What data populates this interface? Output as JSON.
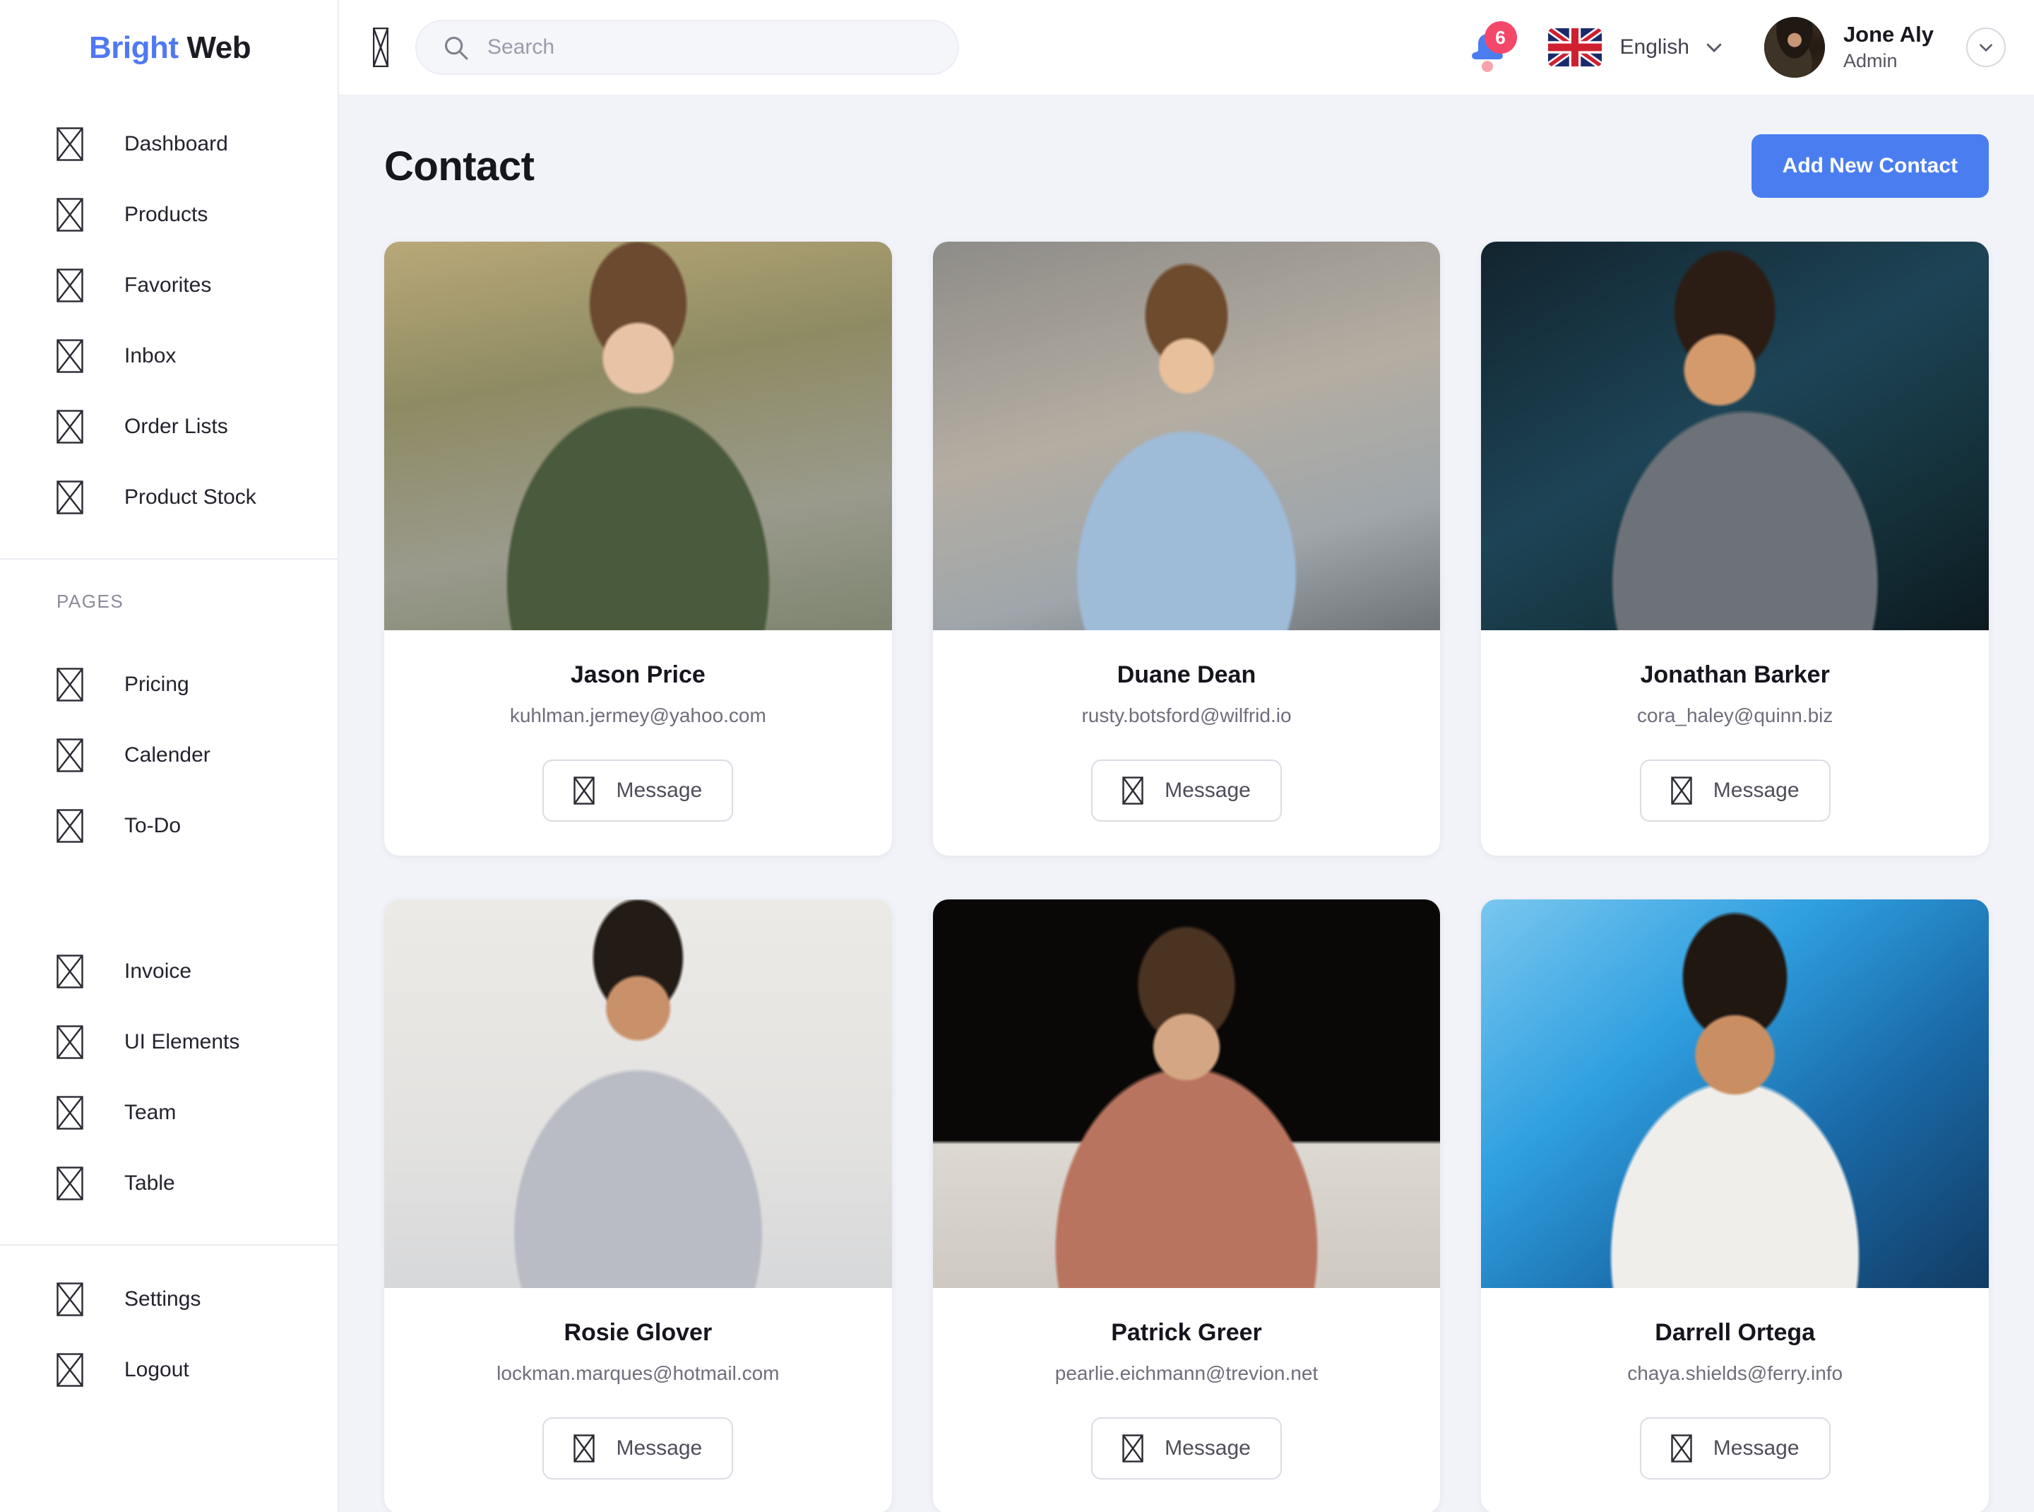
{
  "brand": {
    "first": "Bright",
    "second": "Web"
  },
  "sidebar": {
    "groups": [
      {
        "items": [
          {
            "label": "Dashboard",
            "icon": "broken-image-icon"
          },
          {
            "label": "Products",
            "icon": "broken-image-icon"
          },
          {
            "label": "Favorites",
            "icon": "broken-image-icon"
          },
          {
            "label": "Inbox",
            "icon": "broken-image-icon"
          },
          {
            "label": "Order Lists",
            "icon": "broken-image-icon"
          },
          {
            "label": "Product Stock",
            "icon": "broken-image-icon"
          }
        ]
      },
      {
        "section": "PAGES",
        "items": [
          {
            "label": "Pricing",
            "icon": "broken-image-icon"
          },
          {
            "label": "Calender",
            "icon": "broken-image-icon"
          },
          {
            "label": "To-Do",
            "icon": "broken-image-icon"
          }
        ]
      },
      {
        "items": [
          {
            "label": "Invoice",
            "icon": "broken-image-icon"
          },
          {
            "label": "UI Elements",
            "icon": "broken-image-icon"
          },
          {
            "label": "Team",
            "icon": "broken-image-icon"
          },
          {
            "label": "Table",
            "icon": "broken-image-icon"
          }
        ]
      },
      {
        "items": [
          {
            "label": "Settings",
            "icon": "broken-image-icon"
          },
          {
            "label": "Logout",
            "icon": "broken-image-icon"
          }
        ]
      }
    ]
  },
  "topbar": {
    "menu_icon": "broken-image-icon",
    "search": {
      "value": "",
      "placeholder": "Search",
      "icon": "search-icon"
    },
    "notifications": {
      "icon": "bell-icon",
      "count": "6",
      "badge_color": "#f4486b",
      "bell_color": "#4a7ef0"
    },
    "language": {
      "label": "English",
      "flag": "uk-flag-icon",
      "caret": "chevron-down-icon"
    },
    "user": {
      "name": "Jone Aly",
      "role": "Admin",
      "avatar": "avatar",
      "caret": "chevron-down-icon"
    }
  },
  "page": {
    "title": "Contact",
    "add_button": "Add New Contact",
    "accent_color": "#4a7ef0",
    "background": "#f1f3f9"
  },
  "contacts": [
    {
      "name": "Jason Price",
      "email": "kuhlman.jermey@yahoo.com",
      "message_label": "Message",
      "message_icon": "broken-image-icon",
      "photo": "p1"
    },
    {
      "name": "Duane Dean",
      "email": "rusty.botsford@wilfrid.io",
      "message_label": "Message",
      "message_icon": "broken-image-icon",
      "photo": "p2"
    },
    {
      "name": "Jonathan Barker",
      "email": "cora_haley@quinn.biz",
      "message_label": "Message",
      "message_icon": "broken-image-icon",
      "photo": "p3"
    },
    {
      "name": "Rosie Glover",
      "email": "lockman.marques@hotmail.com",
      "message_label": "Message",
      "message_icon": "broken-image-icon",
      "photo": "p4"
    },
    {
      "name": "Patrick Greer",
      "email": "pearlie.eichmann@trevion.net",
      "message_label": "Message",
      "message_icon": "broken-image-icon",
      "photo": "p5"
    },
    {
      "name": "Darrell Ortega",
      "email": "chaya.shields@ferry.info",
      "message_label": "Message",
      "message_icon": "broken-image-icon",
      "photo": "p6"
    }
  ]
}
